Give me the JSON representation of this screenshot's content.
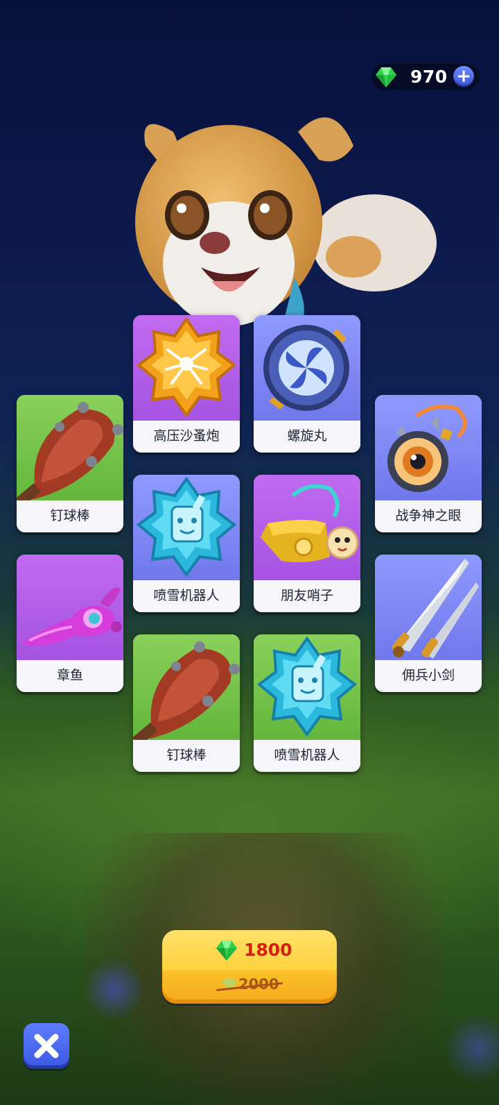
{
  "currency": {
    "gems": "970",
    "add_label": "+"
  },
  "items": [
    {
      "label": "高压沙蚤炮",
      "icon": "gold-spider-star-icon",
      "bg": "purple"
    },
    {
      "label": "螺旋丸",
      "icon": "spiral-orb-icon",
      "bg": "blue"
    },
    {
      "label": "钉球棒",
      "icon": "spiked-club-icon",
      "bg": "green"
    },
    {
      "label": "喷雪机器人",
      "icon": "ice-robot-star-icon",
      "bg": "blue"
    },
    {
      "label": "朋友哨子",
      "icon": "whistle-icon",
      "bg": "purple"
    },
    {
      "label": "战争神之眼",
      "icon": "war-eye-icon",
      "bg": "blue"
    },
    {
      "label": "章鱼",
      "icon": "octopus-icon",
      "bg": "purple"
    },
    {
      "label": "佣兵小剑",
      "icon": "twin-daggers-icon",
      "bg": "blue"
    },
    {
      "label": "钉球棒",
      "icon": "spiked-club-icon",
      "bg": "green"
    },
    {
      "label": "喷雪机器人",
      "icon": "ice-robot-star-icon",
      "bg": "green"
    }
  ],
  "purchase": {
    "price": "1800",
    "original_price": "2000"
  },
  "colors": {
    "accent_blue": "#3a57e0",
    "button_yellow": "#fcc22b",
    "price_red": "#d3210d"
  }
}
